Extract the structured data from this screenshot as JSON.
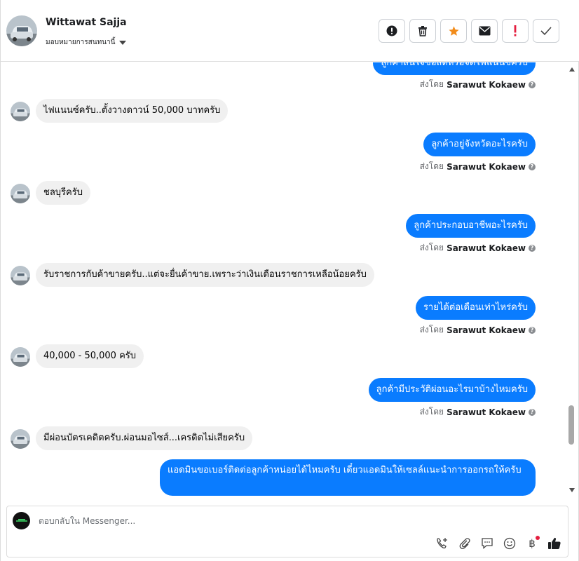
{
  "header": {
    "name": "Wittawat Sajja",
    "assign_label": "มอบหมายการสนทนานี้"
  },
  "messages": [
    {
      "dir": "out",
      "text": "ลูกค้าสนใจซื้อสดหรือจัดไฟแนนซ์ครับ",
      "sent_by_label": "ส่งโดย",
      "sender": "Sarawut Kokaew"
    },
    {
      "dir": "in",
      "text": "ไฟแนนซ์ครับ..ตั้งวางดาวน์ 50,000 บาทครับ"
    },
    {
      "dir": "out",
      "text": "ลูกค้าอยู่จังหวัดอะไรครับ",
      "sent_by_label": "ส่งโดย",
      "sender": "Sarawut Kokaew"
    },
    {
      "dir": "in",
      "text": "ชลบุรีครับ"
    },
    {
      "dir": "out",
      "text": "ลูกค้าประกอบอาชีพอะไรครับ",
      "sent_by_label": "ส่งโดย",
      "sender": "Sarawut Kokaew"
    },
    {
      "dir": "in",
      "text": "รับราชการกับค้าขายครับ..แต่จะยื่นค้าขาย.เพราะว่าเงินเดือนราชการเหลือน้อยครับ"
    },
    {
      "dir": "out",
      "text": "รายได้ต่อเดือนเท่าไหร่ครับ",
      "sent_by_label": "ส่งโดย",
      "sender": "Sarawut Kokaew"
    },
    {
      "dir": "in",
      "text": "40,000 - 50,000 ครับ"
    },
    {
      "dir": "out",
      "text": "ลูกค้ามีประวัติผ่อนอะไรมาบ้างไหมครับ",
      "sent_by_label": "ส่งโดย",
      "sender": "Sarawut Kokaew"
    },
    {
      "dir": "in",
      "text": "มีผ่อนบัตรเคดิตครับ.ผ่อนมอไซส์...เครดิตไม่เสียครับ"
    },
    {
      "dir": "out",
      "text": "แอดมินขอเบอร์ติดต่อลูกค้าหน่อยได้ไหมครับ เดี๋ยวแอดมินให้เซลล์แนะนำการออกรถให้ครับ"
    }
  ],
  "composer": {
    "placeholder": "ตอบกลับใน Messenger..."
  },
  "colors": {
    "outgoing_bubble": "#0a7cff",
    "incoming_bubble": "#f0f0f0",
    "star": "#f28c1a",
    "important": "#e41e3f"
  },
  "icons": {
    "header_actions": [
      "spam-icon",
      "trash-icon",
      "star-icon",
      "mail-icon",
      "important-icon",
      "check-icon"
    ],
    "composer_tools": [
      "call-add-icon",
      "paperclip-icon",
      "saved-reply-icon",
      "emoji-icon",
      "baht-icon",
      "like-icon"
    ]
  }
}
